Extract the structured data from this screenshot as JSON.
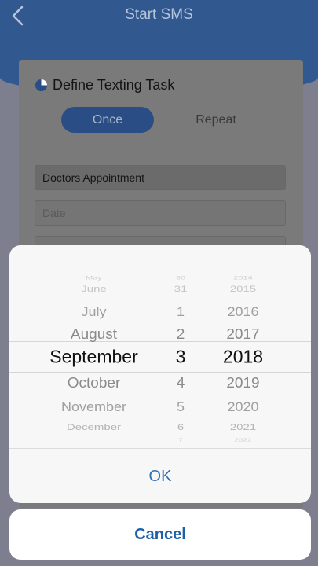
{
  "header": {
    "title": "Start SMS",
    "back_icon": "chevron-left-icon"
  },
  "card": {
    "title": "Define Texting Task",
    "title_icon": "clock-icon",
    "tabs": [
      {
        "label": "Once",
        "active": true
      },
      {
        "label": "Repeat",
        "active": false
      }
    ],
    "task_name_value": "Doctors Appointment",
    "date_placeholder": "Date"
  },
  "picker": {
    "months": [
      "May",
      "June",
      "July",
      "August",
      "September",
      "October",
      "November",
      "December"
    ],
    "days": [
      "30",
      "31",
      "1",
      "2",
      "3",
      "4",
      "5",
      "6",
      "7"
    ],
    "years": [
      "2014",
      "2015",
      "2016",
      "2017",
      "2018",
      "2019",
      "2020",
      "2021",
      "2022"
    ],
    "selected": {
      "month": "September",
      "day": "3",
      "year": "2018"
    },
    "ok_label": "OK"
  },
  "cancel_label": "Cancel",
  "colors": {
    "accent": "#2f6fb5",
    "header": "#31588f",
    "dim_overlay": "#7d7f8e"
  }
}
